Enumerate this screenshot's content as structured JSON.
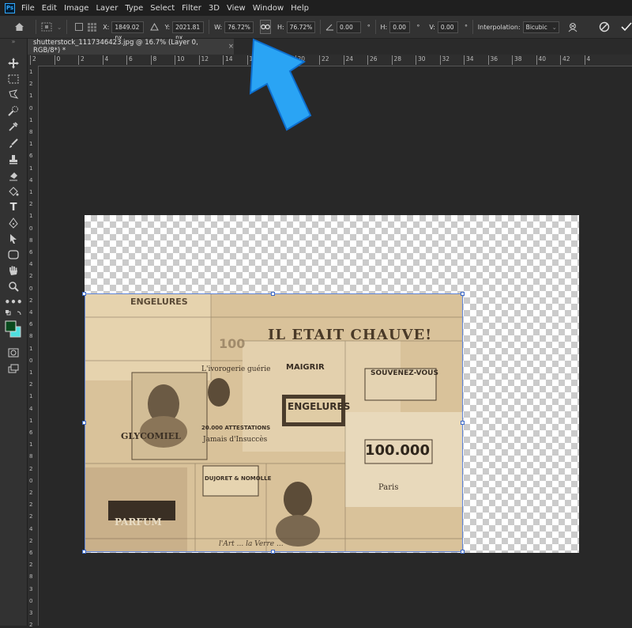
{
  "app": {
    "logo_text": "Ps"
  },
  "menu": [
    "File",
    "Edit",
    "Image",
    "Layer",
    "Type",
    "Select",
    "Filter",
    "3D",
    "View",
    "Window",
    "Help"
  ],
  "options": {
    "x_label": "X:",
    "x_value": "1849.02 px",
    "y_label": "Y:",
    "y_value": "2021.81 px",
    "w_label": "W:",
    "w_value": "76.72%",
    "h_label": "H:",
    "h_value": "76.72%",
    "angle_value": "0.00",
    "angle_unit": "°",
    "hskew_label": "H:",
    "hskew_value": "0.00",
    "hskew_unit": "°",
    "vskew_label": "V:",
    "vskew_value": "0.00",
    "vskew_unit": "°",
    "interp_label": "Interpolation:",
    "interp_value": "Bicubic"
  },
  "document": {
    "tab_title": "shutterstock_1117346423.jpg @ 16.7% (Layer 0, RGB/8*) *",
    "close": "×"
  },
  "ruler_top": [
    "2",
    "0",
    "2",
    "4",
    "6",
    "8",
    "10",
    "12",
    "14",
    "16",
    "18",
    "20",
    "22",
    "24",
    "26",
    "28",
    "30",
    "32",
    "34",
    "36",
    "38",
    "40",
    "42",
    "4"
  ],
  "ruler_left": [
    "1",
    "2",
    "1",
    "0",
    "1",
    "8",
    "1",
    "6",
    "1",
    "4",
    "1",
    "2",
    "1",
    "0",
    "8",
    "6",
    "4",
    "2",
    "0",
    "2",
    "4",
    "6",
    "8",
    "1",
    "0",
    "1",
    "2",
    "1",
    "4",
    "1",
    "6",
    "1",
    "8",
    "2",
    "0",
    "2",
    "2",
    "2",
    "4",
    "2",
    "6",
    "2",
    "8",
    "3",
    "0",
    "3",
    "2"
  ],
  "newspaper": {
    "headline": "IL ETAIT CHAUVE!",
    "ivory": "L'ivorogerie guérie",
    "glyco": "GLYCOMIEL",
    "engelures": "ENGELURES",
    "souvenez": "SOUVENEZ-VOUS",
    "hundredk": "100.000",
    "maigrir": "MAIGRIR",
    "attest": "20.000 ATTESTATIONS",
    "jamais": "Jamais d'Insuccès",
    "parfum": "PARFUM",
    "paris": "Paris",
    "hundred_small": "100",
    "capsules": "DUJORET & NOMOLLE",
    "bottom_script": "l'Art ... la Verre ..."
  },
  "colors": {
    "accent": "#31a8ff",
    "arrow": "#2aa4f4",
    "handle_border": "#3b68c7",
    "fg_swatch": "#0a4a1e",
    "bg_swatch": "#4fe0e0"
  }
}
